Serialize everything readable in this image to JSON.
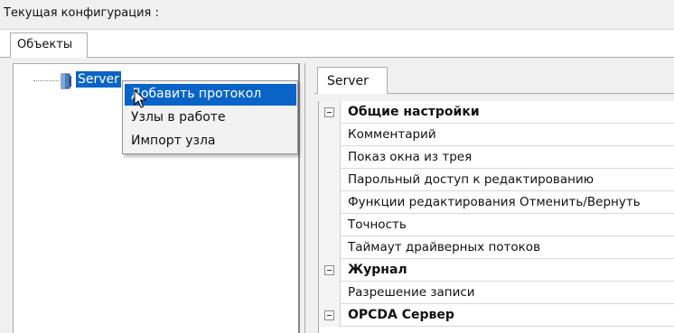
{
  "window": {
    "title": "Текущая конфигурация :"
  },
  "tabs": {
    "objects": "Объекты"
  },
  "tree": {
    "root_label": "Server",
    "root_icon": "server-node-icon"
  },
  "context_menu": {
    "items": [
      {
        "label": "Добавить протокол",
        "highlighted": true
      },
      {
        "label": "Узлы в работе"
      },
      {
        "label": "Импорт узла"
      }
    ]
  },
  "property_panel": {
    "tab_label": "Server",
    "rows": [
      {
        "label": "Общие настройки",
        "category": true
      },
      {
        "label": "Комментарий"
      },
      {
        "label": "Показ окна из трея"
      },
      {
        "label": "Парольный доступ к редактированию"
      },
      {
        "label": "Функции редактирования Отменить/Вернуть"
      },
      {
        "label": "Точность"
      },
      {
        "label": "Таймаут драйверных потоков"
      },
      {
        "label": "Журнал",
        "category": true
      },
      {
        "label": "Разрешение записи"
      },
      {
        "label": "OPCDA Сервер",
        "category": true
      }
    ]
  },
  "colors": {
    "selection": "#0a64c8",
    "panel_bg": "#f0f0f0"
  }
}
